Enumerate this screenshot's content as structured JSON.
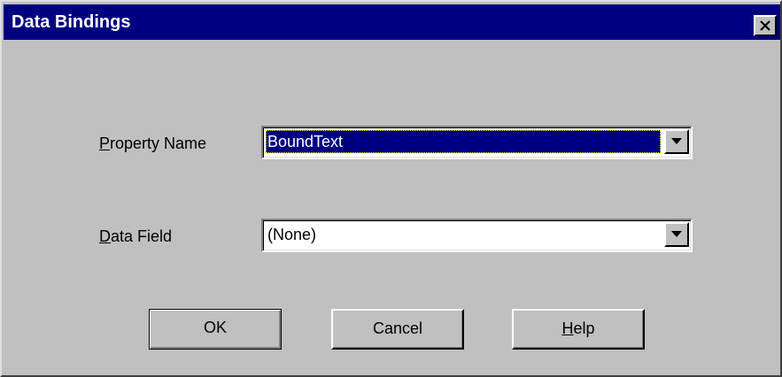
{
  "window": {
    "title": "Data Bindings"
  },
  "property_name": {
    "label_accel": "P",
    "label_rest": "roperty Name",
    "selected_value": "BoundText"
  },
  "data_field": {
    "label_accel": "D",
    "label_rest": "ata Field",
    "selected_value": "(None)"
  },
  "buttons": {
    "ok_label": "OK",
    "cancel_label": "Cancel",
    "help_accel": "H",
    "help_rest": "elp"
  },
  "icons": {
    "close": "close-icon",
    "dropdown": "chevron-down-icon"
  },
  "colors": {
    "titlebar": "#000080",
    "face": "#c0c0c0",
    "selection": "#000080"
  }
}
